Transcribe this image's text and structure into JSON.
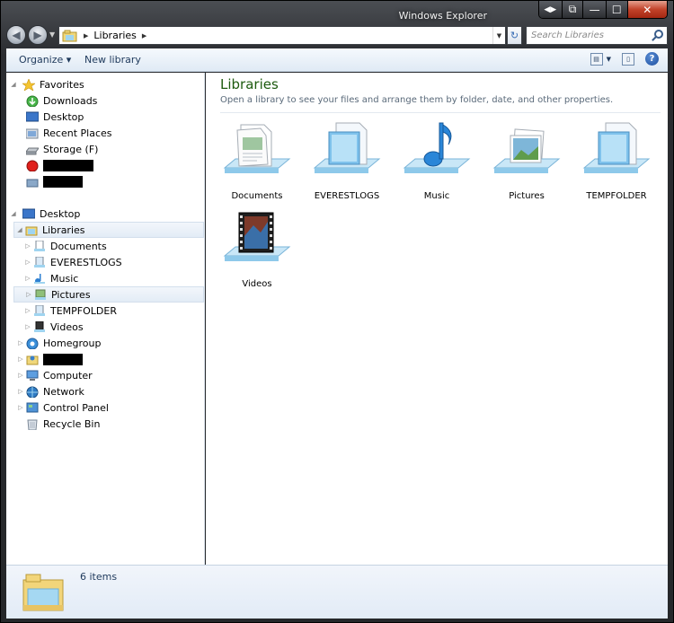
{
  "window": {
    "title": "Windows Explorer"
  },
  "caption": {
    "prev": "◀▶",
    "restore_alt": "⧉",
    "minimize": "—",
    "maximize": "☐",
    "close": "✕"
  },
  "nav": {
    "back": "◀",
    "forward": "▶",
    "dropdown": "▼"
  },
  "address": {
    "crumbs": [
      "Libraries"
    ],
    "dropdown": "▼"
  },
  "search": {
    "placeholder": "Search Libraries"
  },
  "toolbar": {
    "organize": "Organize",
    "organize_arrow": "▾",
    "new_library": "New library",
    "help": "?"
  },
  "navpane": {
    "favorites": {
      "label": "Favorites",
      "items": [
        "Downloads",
        "Desktop",
        "Recent Places",
        "Storage (F)"
      ]
    },
    "desktop": "Desktop",
    "libraries": {
      "label": "Libraries",
      "items": [
        "Documents",
        "EVERESTLOGS",
        "Music",
        "Pictures",
        "TEMPFOLDER",
        "Videos"
      ]
    },
    "other": [
      "Homegroup",
      "Computer",
      "Network",
      "Control Panel",
      "Recycle Bin"
    ]
  },
  "content": {
    "title": "Libraries",
    "subtitle": "Open a library to see your files and arrange them by folder, date, and other properties.",
    "libraries": [
      "Documents",
      "EVERESTLOGS",
      "Music",
      "Pictures",
      "TEMPFOLDER",
      "Videos"
    ]
  },
  "status": {
    "count": "6 items"
  },
  "colors": {
    "title_green": "#1e5b10",
    "toolbar_text": "#1e395b",
    "selection": "#e3ecf6"
  }
}
